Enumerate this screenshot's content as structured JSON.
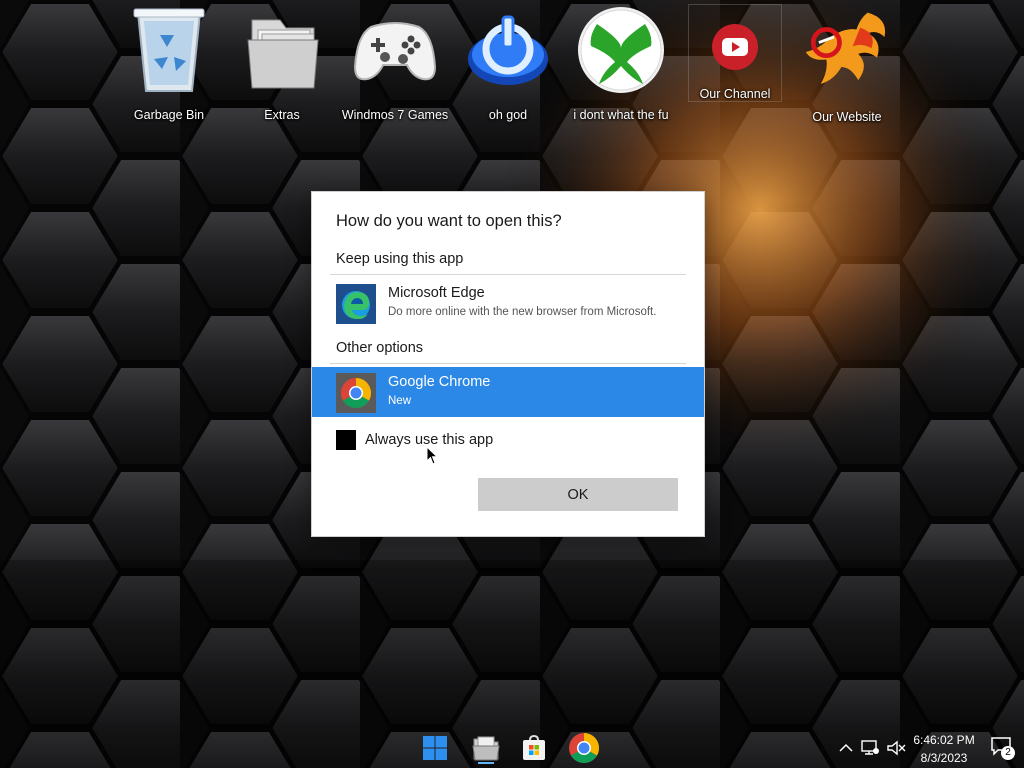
{
  "desktop": {
    "icons": [
      {
        "label": "Garbage Bin",
        "icon": "recycle-bin-icon"
      },
      {
        "label": "Extras",
        "icon": "folder-icon"
      },
      {
        "label": "Windmos 7 Games",
        "icon": "game-controller-icon"
      },
      {
        "label": "oh god",
        "icon": "power-icon"
      },
      {
        "label": "i dont what the fu",
        "icon": "xbox-icon"
      },
      {
        "label": "Our Channel",
        "icon": "youtube-icon"
      },
      {
        "label": "Our Website",
        "icon": "phoenix-logo-icon"
      }
    ]
  },
  "dialog": {
    "title": "How do you want to open this?",
    "keep_label": "Keep using this app",
    "current_app": {
      "name": "Microsoft Edge",
      "subtitle": "Do more online with the new browser from Microsoft.",
      "icon": "edge-icon"
    },
    "other_label": "Other options",
    "other_apps": [
      {
        "name": "Google Chrome",
        "subtitle": "New",
        "icon": "chrome-icon",
        "selected": true
      }
    ],
    "checkbox_label": "Always use this app",
    "ok_label": "OK"
  },
  "taskbar": {
    "apps": [
      {
        "icon": "start-icon"
      },
      {
        "icon": "file-explorer-icon",
        "running": true
      },
      {
        "icon": "store-icon"
      },
      {
        "icon": "chrome-icon"
      }
    ],
    "tray": {
      "icons": [
        "chevron-up-icon",
        "network-icon",
        "volume-muted-icon"
      ]
    },
    "clock": {
      "time": "6:46:02 PM",
      "date": "8/3/2023"
    },
    "notifications": {
      "count": "2",
      "icon": "notification-icon"
    }
  },
  "colors": {
    "accent": "#2b88e6",
    "ok_button": "#cccccc",
    "wallpaper_dark": "#1a1a1c",
    "wallpaper_glow": "#ff9a30"
  }
}
